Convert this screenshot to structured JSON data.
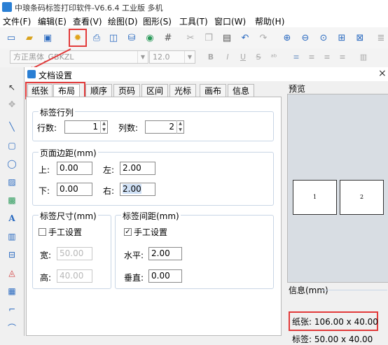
{
  "app": {
    "title": "中琅条码标签打印软件-V6.6.4 工业版 多机",
    "logo_icon": "app-logo-icon"
  },
  "menu": [
    "文件(F)",
    "编辑(E)",
    "查看(V)",
    "绘图(D)",
    "图形(S)",
    "工具(T)",
    "窗口(W)",
    "帮助(H)"
  ],
  "font_toolbar": {
    "font_name": "方正黑体_GBKZL",
    "font_size": "12.0",
    "bold": "B",
    "italic": "I",
    "underline": "U",
    "strike": "S"
  },
  "dialog": {
    "title": "文档设置",
    "close": "×",
    "tabs": [
      "纸张",
      "布局",
      "顺序",
      "页码",
      "区间",
      "光标",
      "画布",
      "信息"
    ],
    "active_tab": "布局",
    "rows_cols": {
      "legend": "标签行列",
      "rows_label": "行数:",
      "rows_value": "1",
      "cols_label": "列数:",
      "cols_value": "2"
    },
    "margins": {
      "legend": "页面边距(mm)",
      "top_label": "上:",
      "top_value": "0.00",
      "left_label": "左:",
      "left_value": "2.00",
      "bottom_label": "下:",
      "bottom_value": "0.00",
      "right_label": "右:",
      "right_value": "2.00"
    },
    "label_size": {
      "legend": "标签尺寸(mm)",
      "manual_label": "手工设置",
      "manual_checked": false,
      "width_label": "宽:",
      "width_value": "50.00",
      "height_label": "高:",
      "height_value": "40.00"
    },
    "label_gap": {
      "legend": "标签间距(mm)",
      "manual_label": "手工设置",
      "manual_checked": true,
      "horizontal_label": "水平:",
      "horizontal_value": "2.00",
      "vertical_label": "垂直:",
      "vertical_value": "0.00"
    }
  },
  "preview": {
    "title": "预览",
    "labels": [
      "1",
      "2"
    ],
    "info_legend": "信息(mm)",
    "paper_info": "纸张: 106.00 x 40.00",
    "label_info": "标签: 50.00 x 40.00"
  },
  "colors": {
    "highlight": "#e23a3a",
    "accent": "#2a7fd4"
  }
}
